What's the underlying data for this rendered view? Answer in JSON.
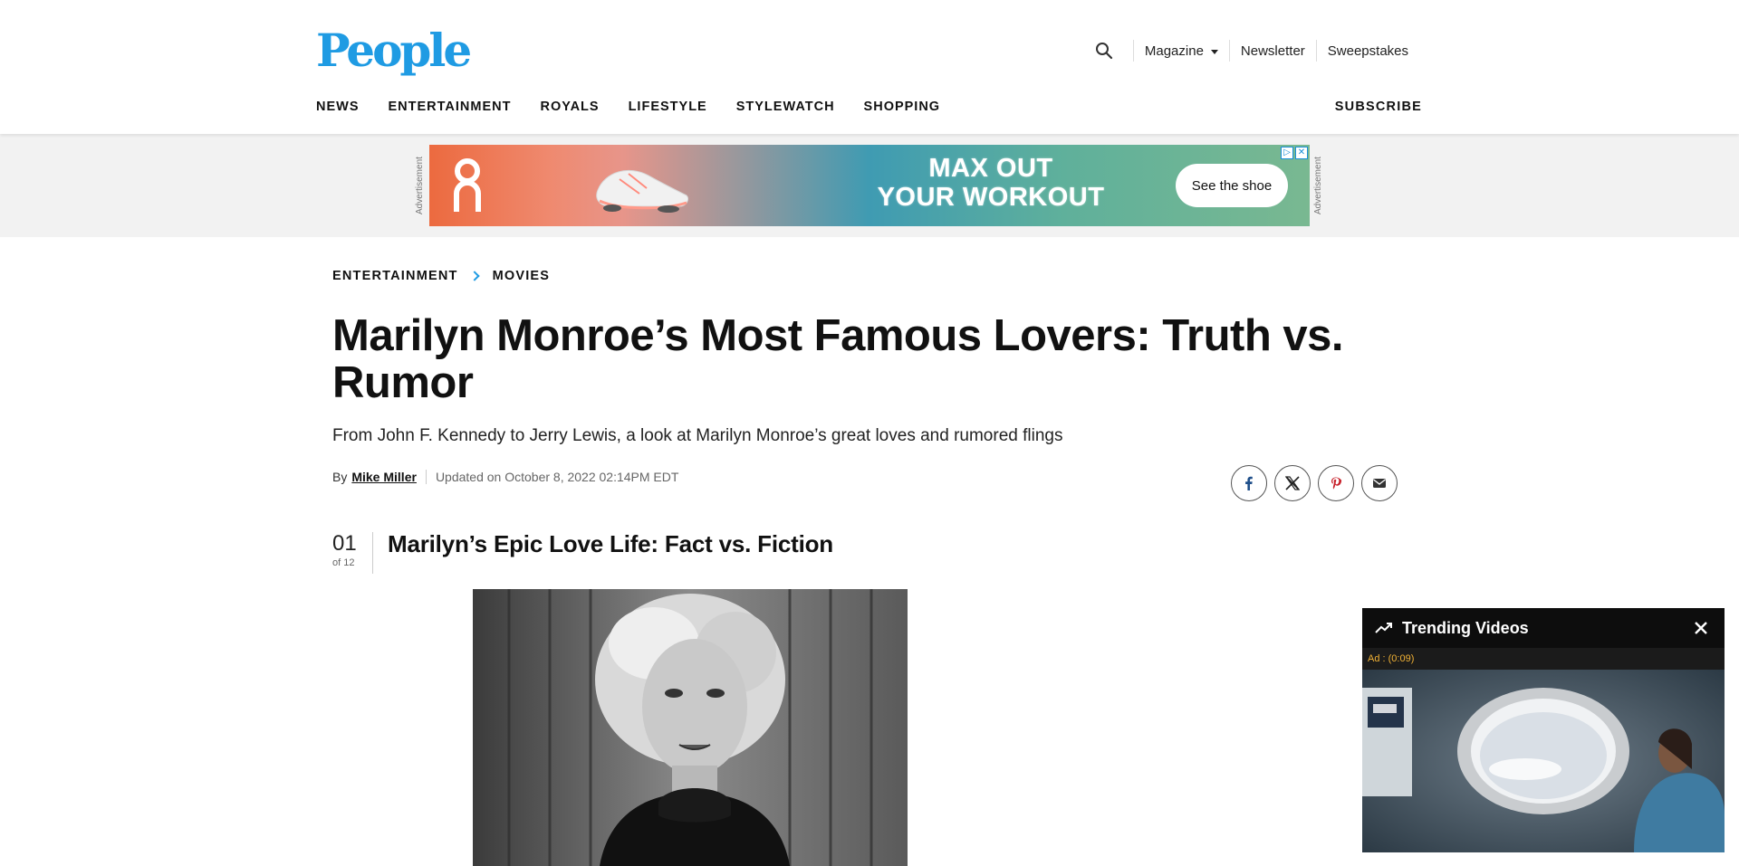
{
  "header": {
    "logo": "People",
    "utility": {
      "magazine": "Magazine",
      "newsletter": "Newsletter",
      "sweepstakes": "Sweepstakes"
    },
    "nav": [
      "NEWS",
      "ENTERTAINMENT",
      "ROYALS",
      "LIFESTYLE",
      "STYLEWATCH",
      "SHOPPING"
    ],
    "subscribe": "SUBSCRIBE"
  },
  "ad": {
    "label": "Advertisement",
    "headline_line1": "MAX OUT",
    "headline_line2": "YOUR WORKOUT",
    "cta": "See the shoe",
    "colors": {
      "left": "#ec6a3f",
      "mid": "#3f9bb2",
      "right": "#79b891"
    }
  },
  "article": {
    "breadcrumb": [
      "ENTERTAINMENT",
      "MOVIES"
    ],
    "title": "Marilyn Monroe’s Most Famous Lovers: Truth vs. Rumor",
    "dek": "From John F. Kennedy to Jerry Lewis, a look at Marilyn Monroe’s great loves and rumored flings",
    "by": "By",
    "author": "Mike Miller",
    "updated": "Updated on October 8, 2022 02:14PM EDT",
    "social": [
      "facebook-icon",
      "x-icon",
      "pinterest-icon",
      "email-icon"
    ],
    "slide": {
      "number": "01",
      "of": "of 12",
      "title": "Marilyn’s Epic Love Life: Fact vs. Fiction"
    }
  },
  "trending": {
    "title": "Trending Videos",
    "ad_timer": "Ad : (0:09)",
    "accent": "#f2b235"
  },
  "colors": {
    "brand": "#1f9be3",
    "pinterest": "#c8232c",
    "facebook": "#1f4f8a"
  }
}
